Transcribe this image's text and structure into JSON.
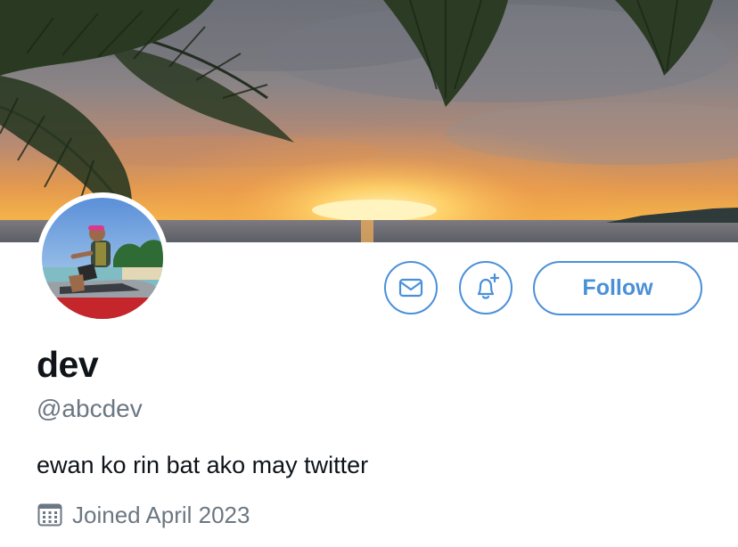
{
  "profile": {
    "display_name": "dev",
    "handle": "@abcdev",
    "bio": "ewan ko rin bat ako may twitter",
    "joined": "Joined April 2023"
  },
  "actions": {
    "message_icon": "envelope-icon",
    "notify_icon": "bell-plus-icon",
    "follow_label": "Follow"
  },
  "icons": {
    "joined_icon": "calendar-icon"
  },
  "colors": {
    "accent": "#4a90d9",
    "secondary_text": "#6b7782",
    "primary_text": "#0f1419"
  }
}
